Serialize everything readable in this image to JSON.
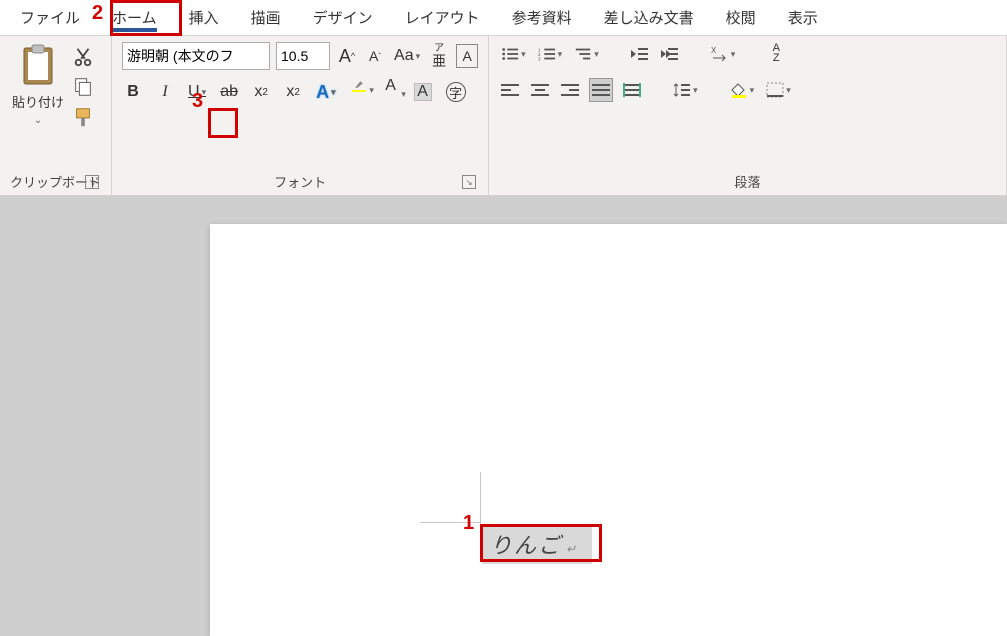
{
  "tabs": [
    "ファイル",
    "ホーム",
    "挿入",
    "描画",
    "デザイン",
    "レイアウト",
    "参考資料",
    "差し込み文書",
    "校閲",
    "表示"
  ],
  "active_tab": 1,
  "clipboard": {
    "paste": "貼り付け",
    "group_label": "クリップボード"
  },
  "font": {
    "name": "游明朝 (本文のフ",
    "size": "10.5",
    "group_label": "フォント",
    "aa": "Aa",
    "ruby_top": "ア",
    "ruby_bottom": "亜",
    "boxed_a": "A",
    "bold": "B",
    "italic": "I",
    "underline": "U",
    "strike": "ab",
    "sub": "x",
    "sub2": "2",
    "sup": "x",
    "sup2": "2",
    "text_effect": "A",
    "highlight": "ab",
    "font_color": "A",
    "shade": "A",
    "char_border": "字"
  },
  "paragraph": {
    "group_label": "段落",
    "sort": "A",
    "sort2": "Z"
  },
  "document": {
    "text": "りんご"
  },
  "annotations": {
    "n1": "1",
    "n2": "2",
    "n3": "3"
  }
}
